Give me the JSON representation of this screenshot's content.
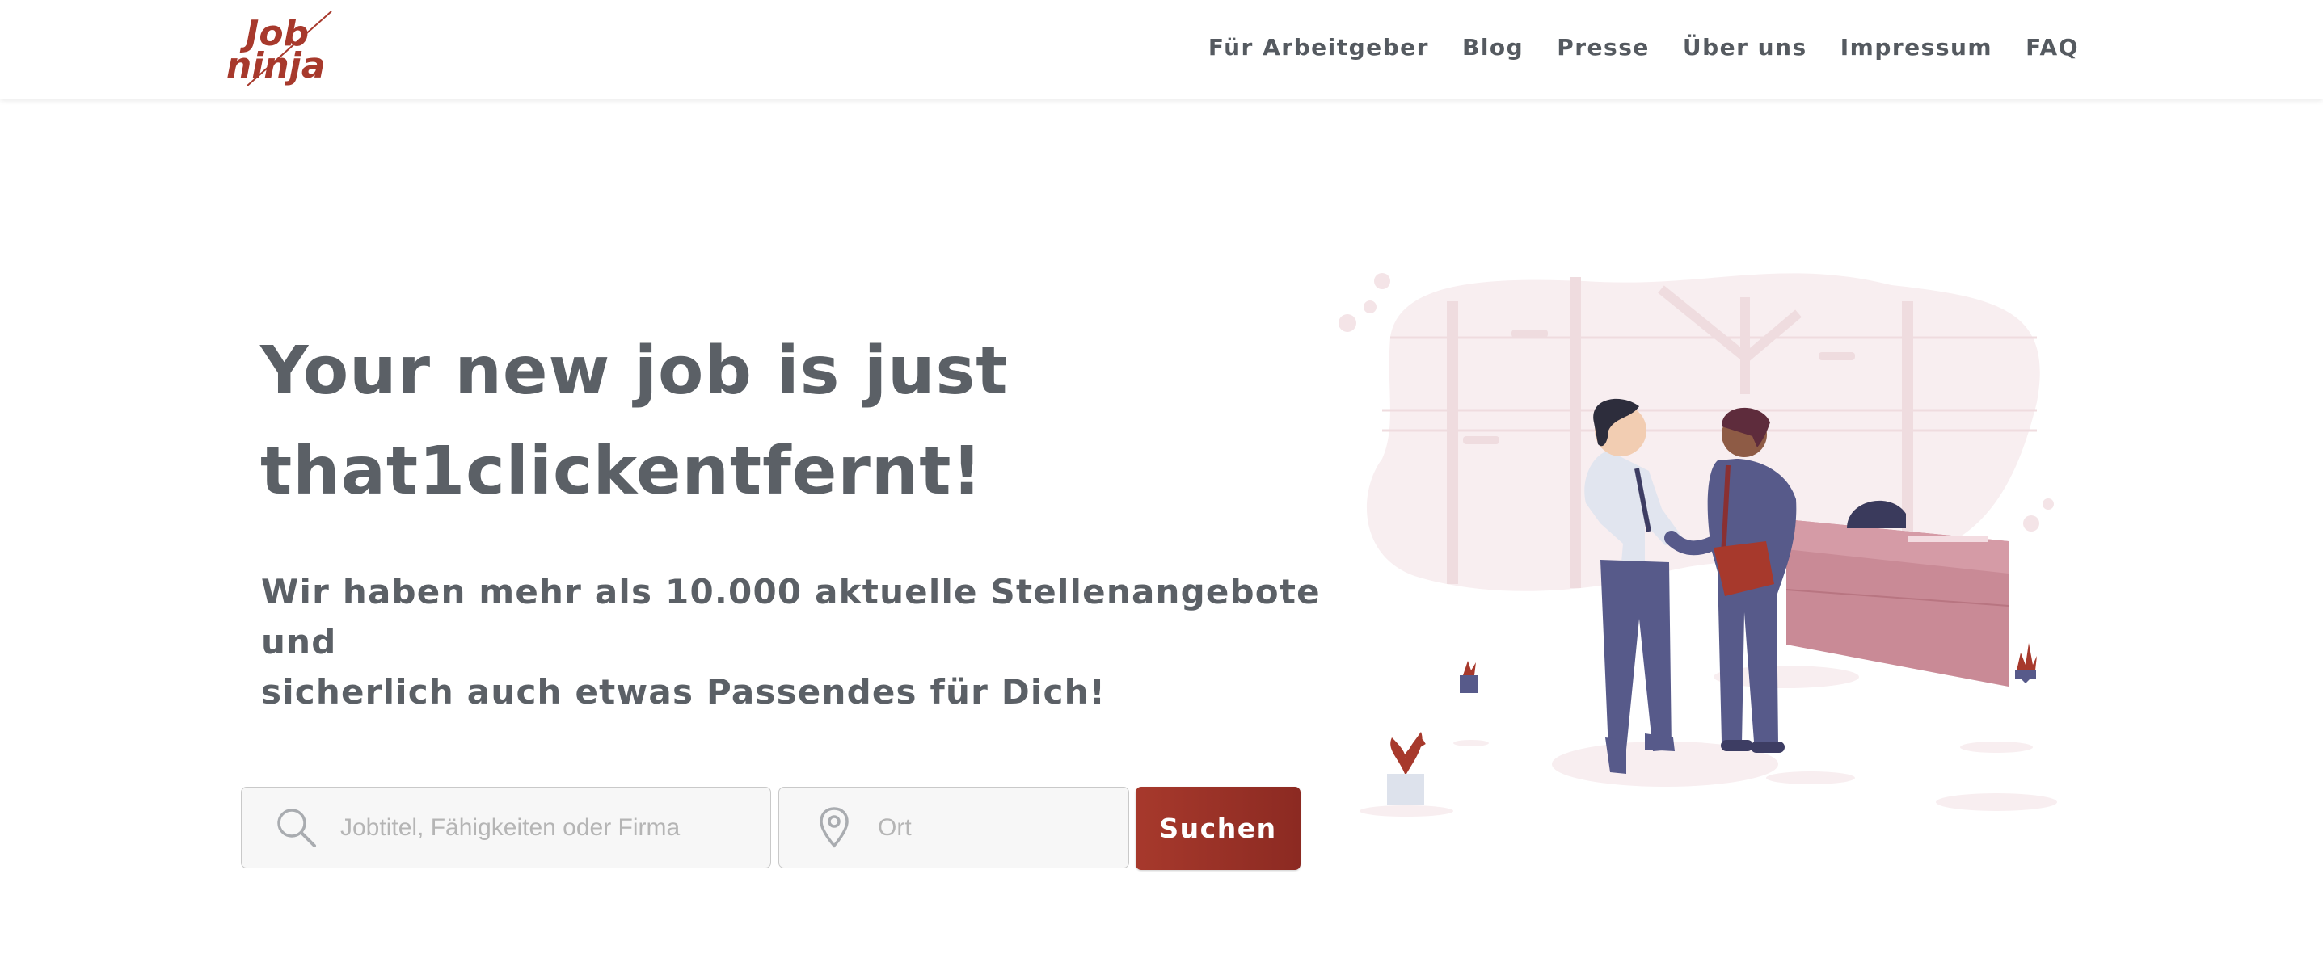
{
  "nav": {
    "logo_text": "Job ninja",
    "items": [
      {
        "label": "Für Arbeitgeber"
      },
      {
        "label": "Blog"
      },
      {
        "label": "Presse"
      },
      {
        "label": "Über uns"
      },
      {
        "label": "Impressum"
      },
      {
        "label": "FAQ"
      }
    ]
  },
  "hero": {
    "title_line1": "Your new job is just",
    "title_line2": "that1clickentfernt!",
    "subtitle_line1": "Wir haben mehr als 10.000 aktuelle Stellenangebote und",
    "subtitle_line2": "sicherlich auch etwas Passendes für Dich!"
  },
  "search": {
    "job_placeholder": "Jobtitel, Fähigkeiten oder Firma",
    "job_value": "",
    "location_placeholder": "Ort",
    "location_value": "",
    "button_label": "Suchen",
    "search_icon": "search-icon",
    "location_icon": "map-pin-icon"
  },
  "colors": {
    "brand": "#a7392c",
    "text": "#5b6066",
    "illustration_bg": "#f8eef0",
    "suit": "#575a8a",
    "desk": "#c98a96"
  }
}
